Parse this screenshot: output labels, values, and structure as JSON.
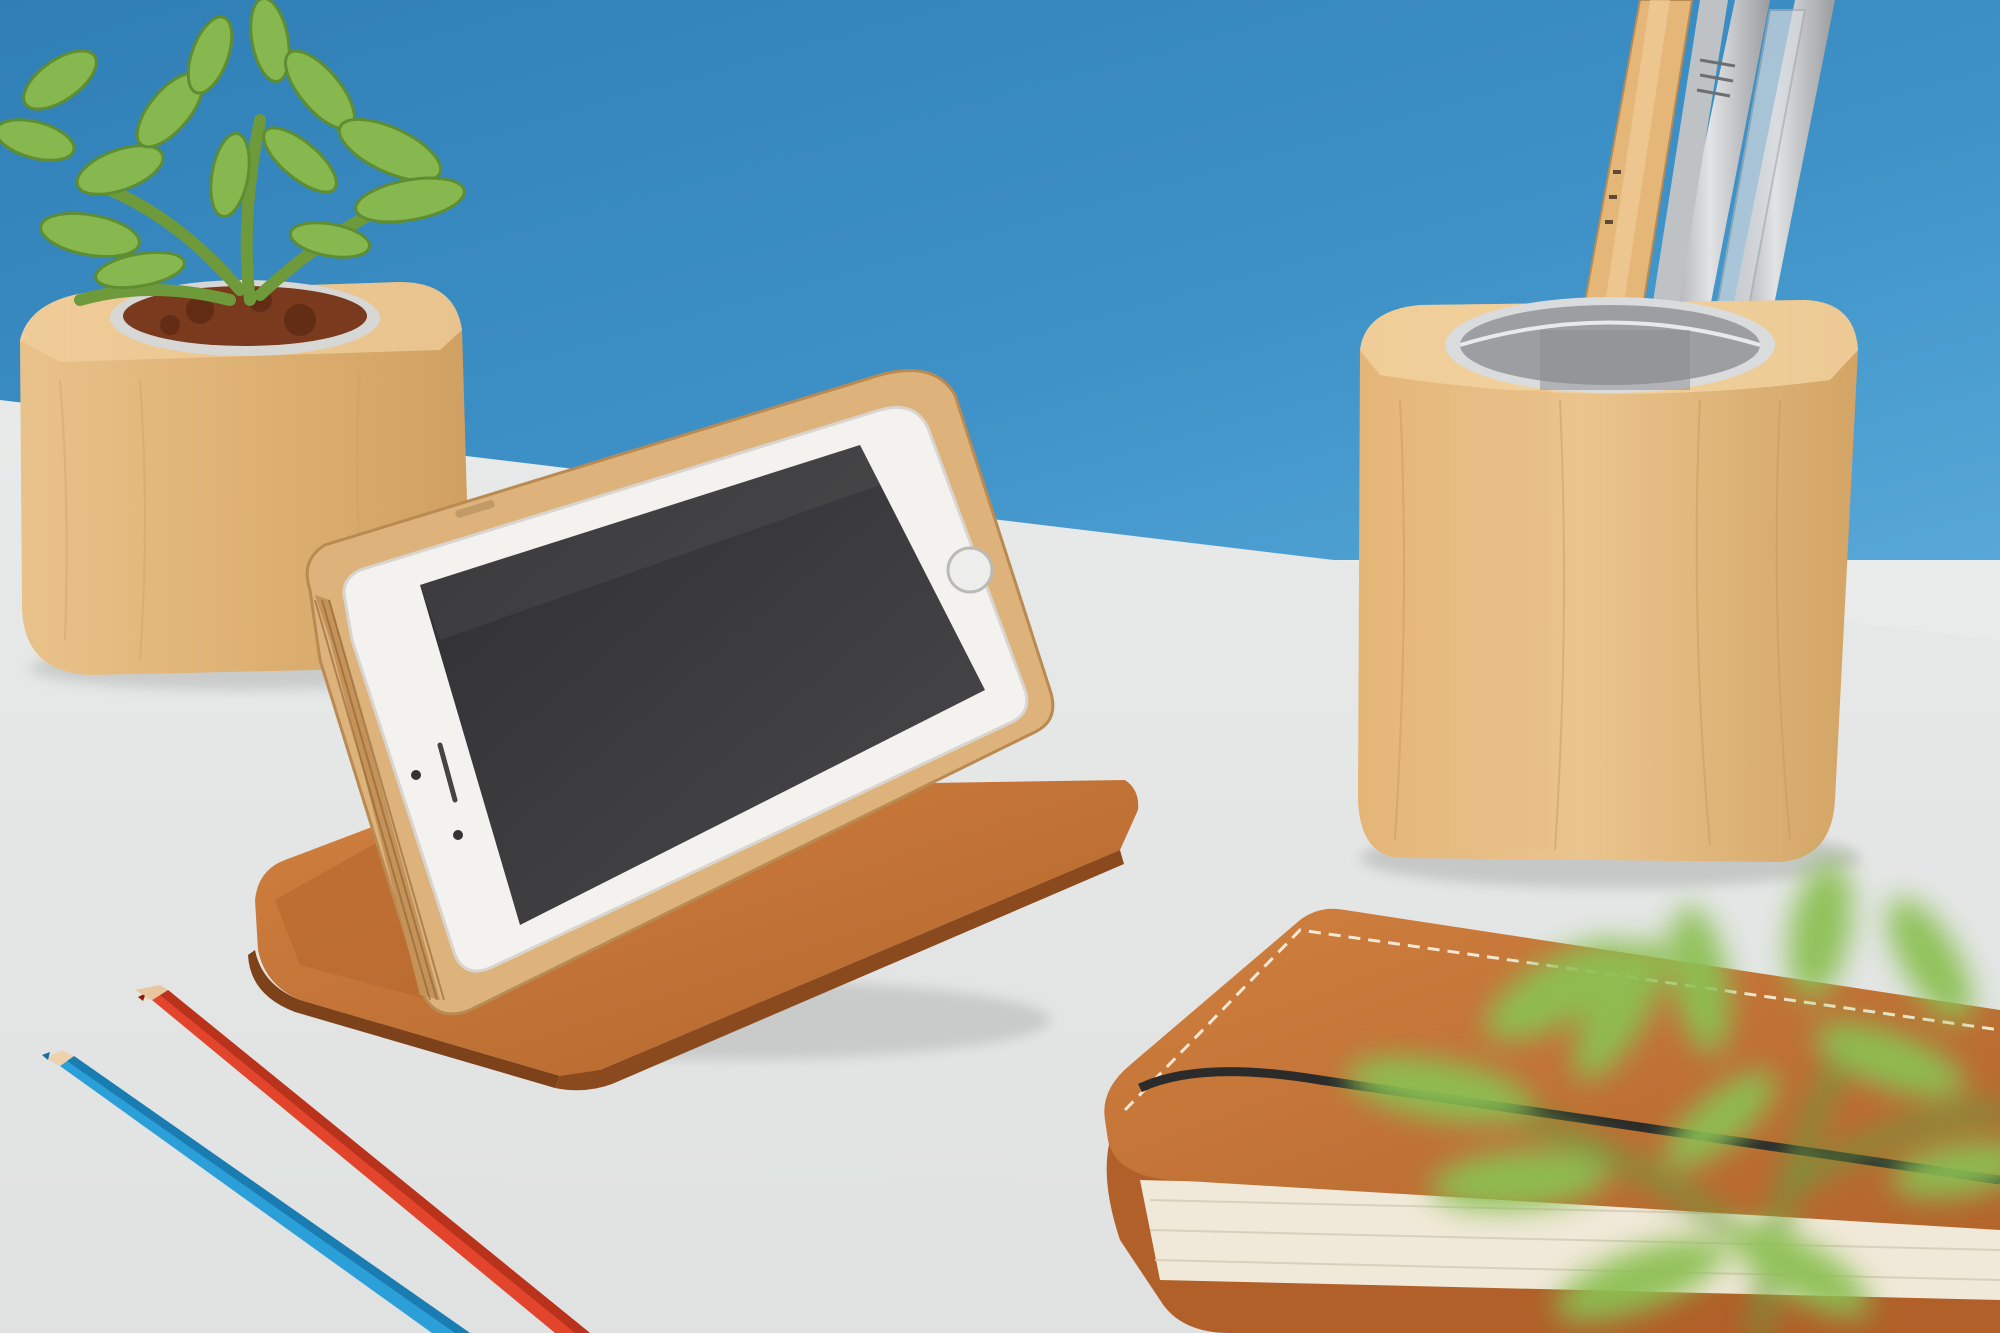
{
  "scene": {
    "colors": {
      "wall": "#3f8fc2",
      "wall_light": "#4fa2d3",
      "desk": "#eceeed",
      "maple": "#e2b77f",
      "maple_dark": "#c79b63",
      "leather": "#c8773a",
      "leather_dark": "#a55a25",
      "succulent": "#7fb34a",
      "pencil_red": "#e2452c",
      "pencil_blue": "#2b9fd8",
      "phone_body": "#f3f1ee",
      "phone_screen": "#3a3a3c"
    },
    "objects": [
      "succulent-planter",
      "phone-stand-with-phone",
      "pen-holder",
      "leather-notebook",
      "colored-pencils",
      "foreground-succulent"
    ]
  }
}
